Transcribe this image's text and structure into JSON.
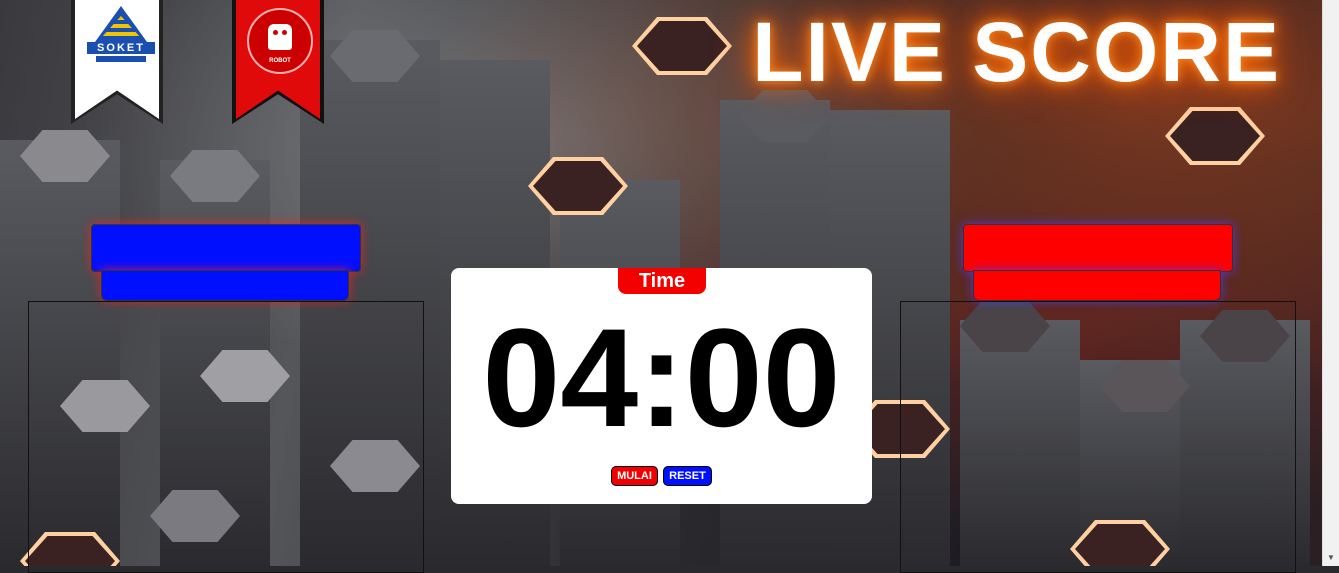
{
  "header": {
    "title": "LIVE SCORE"
  },
  "logos": {
    "left": {
      "name": "soket-logo",
      "text": "SOKET"
    },
    "right": {
      "name": "robot-logo",
      "text": "ROBOT"
    }
  },
  "teams": {
    "left": {
      "name": "",
      "sub": "",
      "color": "#0010ff"
    },
    "right": {
      "name": "",
      "sub": "",
      "color": "#ff0000"
    }
  },
  "timer": {
    "label": "Time",
    "value": "04:00",
    "start_label": "MULAI",
    "reset_label": "RESET"
  },
  "colors": {
    "accent_red": "#f30000",
    "accent_blue": "#0010ff",
    "title_glow": "#ff6a00"
  }
}
